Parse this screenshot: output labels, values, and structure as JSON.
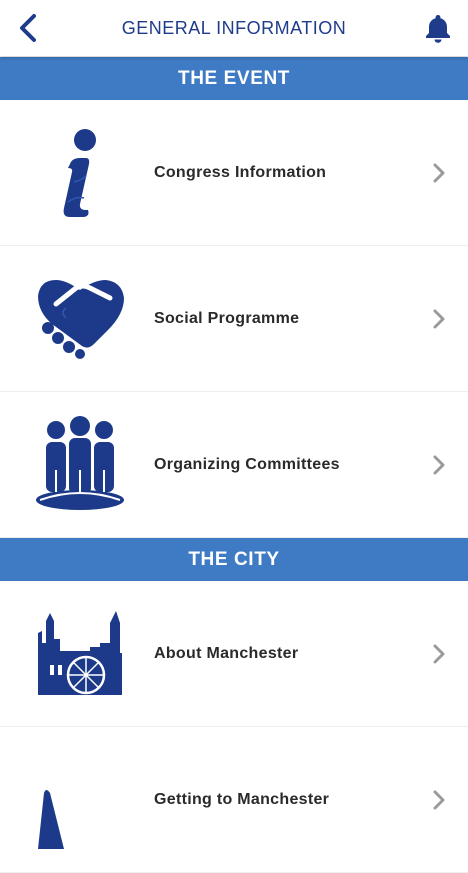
{
  "header": {
    "title": "GENERAL INFORMATION",
    "back_icon": "chevron-left-icon",
    "notification_icon": "bell-icon"
  },
  "sections": [
    {
      "title": "THE EVENT",
      "items": [
        {
          "label": "Congress Information",
          "icon": "info-icon"
        },
        {
          "label": "Social Programme",
          "icon": "handshake-icon"
        },
        {
          "label": "Organizing Committees",
          "icon": "people-group-icon"
        }
      ]
    },
    {
      "title": "THE CITY",
      "items": [
        {
          "label": "About Manchester",
          "icon": "city-skyline-icon"
        },
        {
          "label": "Getting to Manchester",
          "icon": "plane-icon"
        }
      ]
    }
  ],
  "colors": {
    "brand": "#1f3c8a",
    "section_header": "#3e7bc4",
    "icon_fill": "#1d3a8a",
    "chevron": "#9a9a9a"
  }
}
